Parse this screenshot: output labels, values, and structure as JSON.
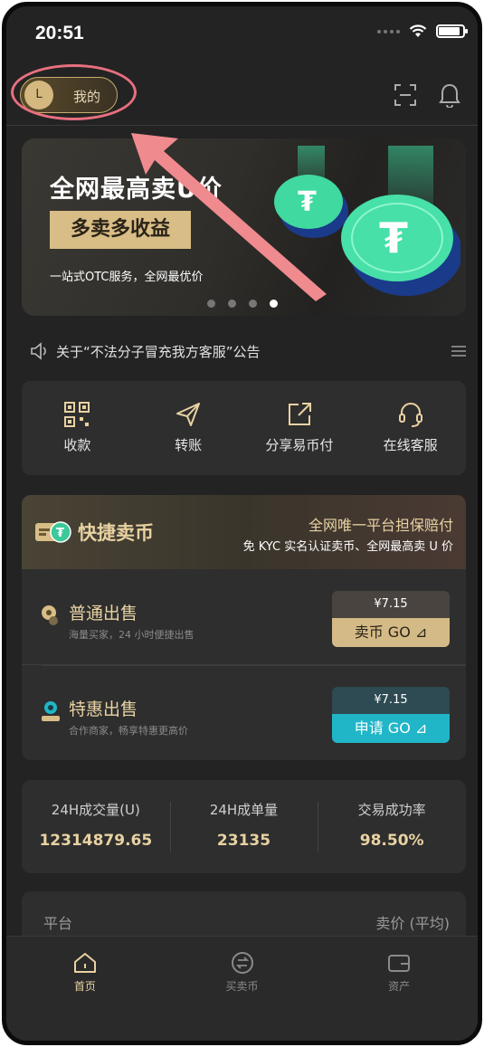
{
  "status_bar": {
    "time": "20:51",
    "battery_level": 0.9
  },
  "header": {
    "avatar_initial": "L",
    "profile_label": "我的",
    "icons": [
      "scan-icon",
      "bell-icon"
    ]
  },
  "banner": {
    "title": "全网最高卖U价",
    "tag": "多卖多收益",
    "subtitle": "一站式OTC服务，全网最优价",
    "active_slide": 4,
    "slide_count": 4
  },
  "notice": {
    "text": "关于“不法分子冒充我方客服”公告"
  },
  "actions": [
    {
      "label": "收款",
      "icon": "qr-code-icon"
    },
    {
      "label": "转账",
      "icon": "send-icon"
    },
    {
      "label": "分享易币付",
      "icon": "share-icon"
    },
    {
      "label": "在线客服",
      "icon": "headset-icon"
    }
  ],
  "quick_sell": {
    "title": "快捷卖币",
    "slogan": "全网唯一平台担保赔付",
    "desc": "免 KYC 实名认证卖币、全网最高卖 U 价",
    "rows": [
      {
        "title": "普通出售",
        "subtitle": "海量买家，24 小时便捷出售",
        "price": "¥7.15",
        "button": "卖币 GO ⊿"
      },
      {
        "title": "特惠出售",
        "subtitle": "合作商家，畅享特惠更高价",
        "price": "¥7.15",
        "button": "申请 GO ⊿"
      }
    ]
  },
  "stats": [
    {
      "label": "24H成交量(U)",
      "value": "12314879.65"
    },
    {
      "label": "24H成单量",
      "value": "23135"
    },
    {
      "label": "交易成功率",
      "value": "98.50%"
    }
  ],
  "platform_table": {
    "col1": "平台",
    "col2": "卖价 (平均)"
  },
  "tabs": [
    {
      "label": "首页",
      "active": true
    },
    {
      "label": "买卖币",
      "active": false
    },
    {
      "label": "资产",
      "active": false
    }
  ],
  "colors": {
    "accent_gold": "#e8d2a2",
    "accent_cyan": "#20b6c8",
    "highlight": "#e86f7f"
  }
}
